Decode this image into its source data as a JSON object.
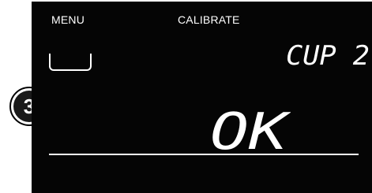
{
  "header": {
    "menu_label": "MENU",
    "title": "CALIBRATE"
  },
  "display": {
    "cup_readout": "CUP 2",
    "main_readout": "OK",
    "cup_icon": "cup-icon"
  },
  "step_badge": {
    "number": "3"
  },
  "colors": {
    "screen_background": "#050505",
    "foreground": "#ffffff"
  }
}
